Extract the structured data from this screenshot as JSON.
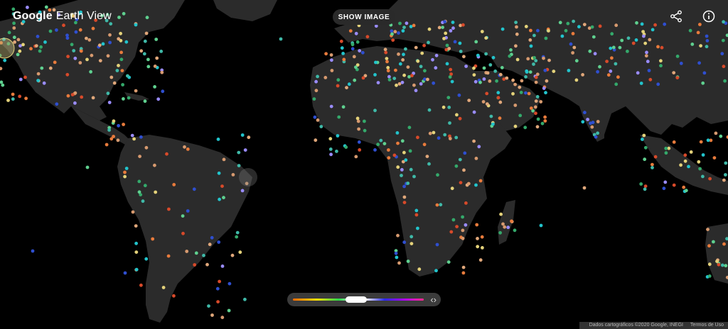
{
  "brand": {
    "google": "Google",
    "product": "Earth View"
  },
  "toolbar": {
    "show_image_label": "SHOW IMAGE"
  },
  "icons": {
    "share": "share-icon",
    "info": "info-icon",
    "arrows": "chevron-left-right-icon"
  },
  "credits": {
    "map_data": "Dados cartográficos ©2020 Google, INEGI",
    "terms": "Termos de Uso"
  },
  "colors": {
    "background": "#000000",
    "land": "#2b2b2b",
    "dot_palette": [
      "#e0a77a",
      "#d79a6f",
      "#3fb9a8",
      "#22c4cc",
      "#5fd08f",
      "#34a96b",
      "#e87b3c",
      "#d84a2a",
      "#2f4fd0",
      "#9a8cff",
      "#e4d27a"
    ]
  },
  "selected_location": "highlight-ring"
}
